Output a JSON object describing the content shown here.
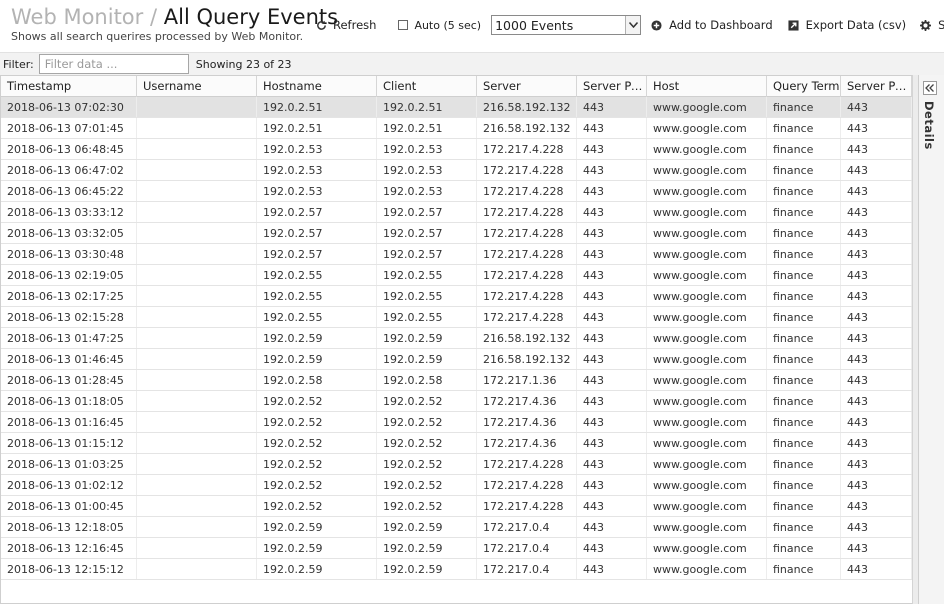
{
  "header": {
    "breadcrumb": "Web Monitor",
    "separator": "/",
    "title": "All Query Events",
    "subtitle": "Shows all search querires processed by Web Monitor."
  },
  "toolbar": {
    "refresh_label": "Refresh",
    "auto_label": "Auto (5 sec)",
    "events_selected": "1000 Events",
    "dashboard_label": "Add to Dashboard",
    "export_label": "Export Data (csv)",
    "settings_label": "S"
  },
  "filter": {
    "label": "Filter:",
    "placeholder": "Filter data ...",
    "showing": "Showing 23 of 23"
  },
  "table": {
    "columns": [
      "Timestamp",
      "Username",
      "Hostname",
      "Client",
      "Server",
      "Server Port",
      "Host",
      "Query Term",
      "Server Port"
    ],
    "rows": [
      [
        "2018-06-13 07:02:30",
        "",
        "192.0.2.51",
        "192.0.2.51",
        "216.58.192.132",
        "443",
        "www.google.com",
        "finance",
        "443"
      ],
      [
        "2018-06-13 07:01:45",
        "",
        "192.0.2.51",
        "192.0.2.51",
        "216.58.192.132",
        "443",
        "www.google.com",
        "finance",
        "443"
      ],
      [
        "2018-06-13 06:48:45",
        "",
        "192.0.2.53",
        "192.0.2.53",
        "172.217.4.228",
        "443",
        "www.google.com",
        "finance",
        "443"
      ],
      [
        "2018-06-13 06:47:02",
        "",
        "192.0.2.53",
        "192.0.2.53",
        "172.217.4.228",
        "443",
        "www.google.com",
        "finance",
        "443"
      ],
      [
        "2018-06-13 06:45:22",
        "",
        "192.0.2.53",
        "192.0.2.53",
        "172.217.4.228",
        "443",
        "www.google.com",
        "finance",
        "443"
      ],
      [
        "2018-06-13 03:33:12",
        "",
        "192.0.2.57",
        "192.0.2.57",
        "172.217.4.228",
        "443",
        "www.google.com",
        "finance",
        "443"
      ],
      [
        "2018-06-13 03:32:05",
        "",
        "192.0.2.57",
        "192.0.2.57",
        "172.217.4.228",
        "443",
        "www.google.com",
        "finance",
        "443"
      ],
      [
        "2018-06-13 03:30:48",
        "",
        "192.0.2.57",
        "192.0.2.57",
        "172.217.4.228",
        "443",
        "www.google.com",
        "finance",
        "443"
      ],
      [
        "2018-06-13 02:19:05",
        "",
        "192.0.2.55",
        "192.0.2.55",
        "172.217.4.228",
        "443",
        "www.google.com",
        "finance",
        "443"
      ],
      [
        "2018-06-13 02:17:25",
        "",
        "192.0.2.55",
        "192.0.2.55",
        "172.217.4.228",
        "443",
        "www.google.com",
        "finance",
        "443"
      ],
      [
        "2018-06-13 02:15:28",
        "",
        "192.0.2.55",
        "192.0.2.55",
        "172.217.4.228",
        "443",
        "www.google.com",
        "finance",
        "443"
      ],
      [
        "2018-06-13 01:47:25",
        "",
        "192.0.2.59",
        "192.0.2.59",
        "216.58.192.132",
        "443",
        "www.google.com",
        "finance",
        "443"
      ],
      [
        "2018-06-13 01:46:45",
        "",
        "192.0.2.59",
        "192.0.2.59",
        "216.58.192.132",
        "443",
        "www.google.com",
        "finance",
        "443"
      ],
      [
        "2018-06-13 01:28:45",
        "",
        "192.0.2.58",
        "192.0.2.58",
        "172.217.1.36",
        "443",
        "www.google.com",
        "finance",
        "443"
      ],
      [
        "2018-06-13 01:18:05",
        "",
        "192.0.2.52",
        "192.0.2.52",
        "172.217.4.36",
        "443",
        "www.google.com",
        "finance",
        "443"
      ],
      [
        "2018-06-13 01:16:45",
        "",
        "192.0.2.52",
        "192.0.2.52",
        "172.217.4.36",
        "443",
        "www.google.com",
        "finance",
        "443"
      ],
      [
        "2018-06-13 01:15:12",
        "",
        "192.0.2.52",
        "192.0.2.52",
        "172.217.4.36",
        "443",
        "www.google.com",
        "finance",
        "443"
      ],
      [
        "2018-06-13 01:03:25",
        "",
        "192.0.2.52",
        "192.0.2.52",
        "172.217.4.228",
        "443",
        "www.google.com",
        "finance",
        "443"
      ],
      [
        "2018-06-13 01:02:12",
        "",
        "192.0.2.52",
        "192.0.2.52",
        "172.217.4.228",
        "443",
        "www.google.com",
        "finance",
        "443"
      ],
      [
        "2018-06-13 01:00:45",
        "",
        "192.0.2.52",
        "192.0.2.52",
        "172.217.4.228",
        "443",
        "www.google.com",
        "finance",
        "443"
      ],
      [
        "2018-06-13 12:18:05",
        "",
        "192.0.2.59",
        "192.0.2.59",
        "172.217.0.4",
        "443",
        "www.google.com",
        "finance",
        "443"
      ],
      [
        "2018-06-13 12:16:45",
        "",
        "192.0.2.59",
        "192.0.2.59",
        "172.217.0.4",
        "443",
        "www.google.com",
        "finance",
        "443"
      ],
      [
        "2018-06-13 12:15:12",
        "",
        "192.0.2.59",
        "192.0.2.59",
        "172.217.0.4",
        "443",
        "www.google.com",
        "finance",
        "443"
      ]
    ]
  },
  "details_panel": {
    "label": "Details"
  },
  "icons": {
    "refresh": "refresh-icon",
    "dashboard": "add-circle-icon",
    "export": "export-icon",
    "settings": "gear-icon",
    "collapse": "double-chevron-left-icon",
    "dropdown": "chevron-down-icon"
  }
}
